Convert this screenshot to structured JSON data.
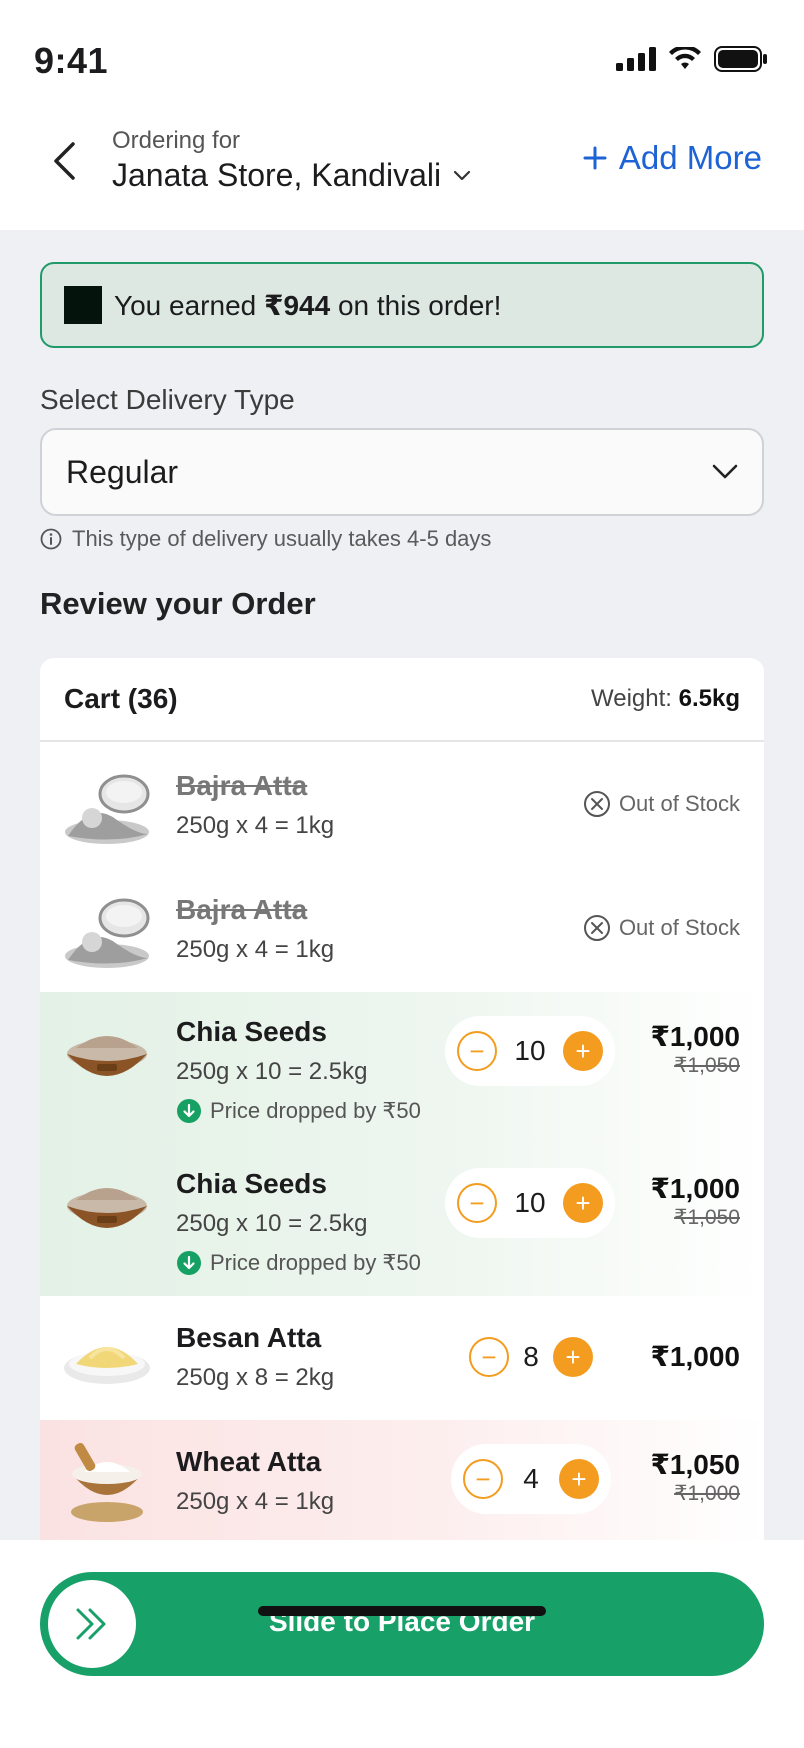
{
  "status_bar": {
    "time": "9:41"
  },
  "header": {
    "ordering_label": "Ordering for",
    "store_name": "Janata Store, Kandivali",
    "add_more_label": "Add More"
  },
  "earned_banner": {
    "prefix": "You earned ",
    "amount": "₹944",
    "suffix": " on this order!"
  },
  "delivery": {
    "section_label": "Select Delivery Type",
    "selected": "Regular",
    "note": "This type of delivery usually takes 4-5 days"
  },
  "review_title": "Review your Order",
  "cart": {
    "title": "Cart (36)",
    "weight_label": "Weight: ",
    "weight_value": "6.5kg",
    "items": [
      {
        "name": "Bajra Atta",
        "qty": "250g x 4 = 1kg",
        "status": "Out of Stock"
      },
      {
        "name": "Bajra Atta",
        "qty": "250g x 4 = 1kg",
        "status": "Out of Stock"
      },
      {
        "name": "Chia Seeds",
        "qty": "250g x 10 = 2.5kg",
        "count": "10",
        "price": "₹1,000",
        "old_price": "₹1,050",
        "note": "Price dropped by ₹50"
      },
      {
        "name": "Chia Seeds",
        "qty": "250g x 10 = 2.5kg",
        "count": "10",
        "price": "₹1,000",
        "old_price": "₹1,050",
        "note": "Price dropped by ₹50"
      },
      {
        "name": "Besan Atta",
        "qty": "250g x 8 = 2kg",
        "count": "8",
        "price": "₹1,000"
      },
      {
        "name": "Wheat Atta",
        "qty": "250g x 4 = 1kg",
        "count": "4",
        "price": "₹1,050",
        "old_price": "₹1,000"
      }
    ]
  },
  "place_order": {
    "label": "Slide to Place Order"
  },
  "colors": {
    "accent_green": "#17a068",
    "accent_blue": "#1e63d6",
    "accent_orange": "#f39c1f"
  }
}
